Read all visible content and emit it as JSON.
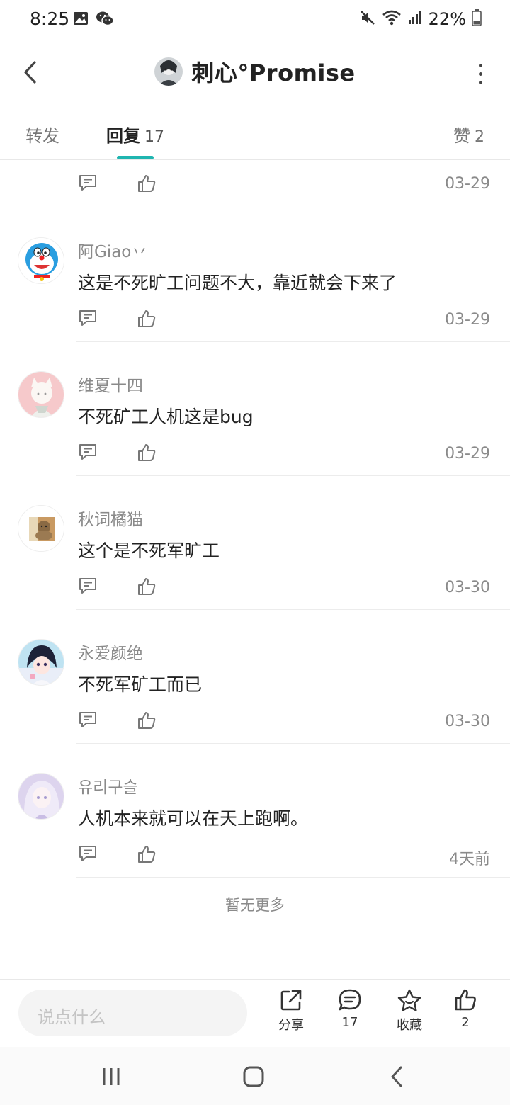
{
  "status_bar": {
    "time": "8:25",
    "battery": "22%",
    "icons_left": [
      "gallery-icon",
      "wechat-icon"
    ],
    "icons_right": [
      "mute-icon",
      "wifi-icon",
      "signal-icon",
      "battery-icon"
    ]
  },
  "header": {
    "title": "刺心°Promise"
  },
  "tabs": {
    "forward": "转发",
    "reply": "回复",
    "reply_count": "17",
    "like": "赞",
    "like_count": "2",
    "active_color": "#1fb5b0"
  },
  "top_partial": {
    "date": "03-29"
  },
  "comments": [
    {
      "name": "阿Giao丷",
      "text": "这是不死旷工问题不大，靠近就会下来了",
      "date": "03-29"
    },
    {
      "name": "维夏十四",
      "text": "不死矿工人机这是bug",
      "date": "03-29"
    },
    {
      "name": "秋词橘猫",
      "text": "这个是不死军旷工",
      "date": "03-30"
    },
    {
      "name": "永爱颜绝",
      "text": "不死军矿工而已",
      "date": "03-30"
    },
    {
      "name": "유리구슬",
      "text": "人机本来就可以在天上跑啊。",
      "date": "4天前"
    }
  ],
  "no_more": "暂无更多",
  "bottom_bar": {
    "input_placeholder": "说点什么",
    "share_label": "分享",
    "comment_count": "17",
    "fav_label": "收藏",
    "like_count": "2"
  }
}
